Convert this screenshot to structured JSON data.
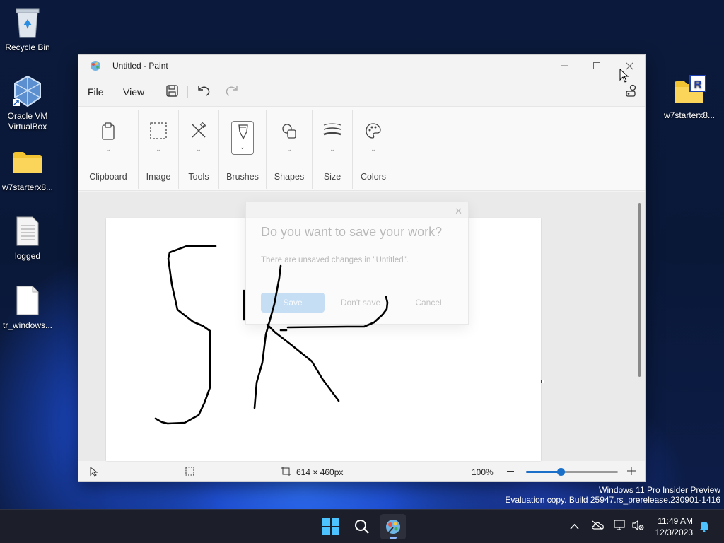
{
  "desktop": {
    "icons": [
      {
        "label": "Recycle Bin",
        "icon": "recycle-bin-icon"
      },
      {
        "label": "Oracle VM VirtualBox",
        "icon": "virtualbox-icon"
      },
      {
        "label": "w7starterx8...",
        "icon": "folder-icon"
      },
      {
        "label": "logged",
        "icon": "text-file-icon"
      },
      {
        "label": "tr_windows...",
        "icon": "file-icon"
      },
      {
        "label": "w7starterx8...",
        "icon": "folder-shortcut-icon"
      }
    ]
  },
  "window": {
    "title": "Untitled - Paint",
    "menu": {
      "file": "File",
      "view": "View"
    },
    "ribbon": {
      "groups": [
        "Clipboard",
        "Image",
        "Tools",
        "Brushes",
        "Shapes",
        "Size",
        "Colors"
      ]
    },
    "dialog": {
      "title": "Do you want to save your work?",
      "message": "There are unsaved changes in \"Untitled\".",
      "save": "Save",
      "dont_save": "Don't save",
      "cancel": "Cancel"
    },
    "status": {
      "canvas_size": "614 × 460px",
      "zoom": "100%",
      "zoom_fraction": 0.38
    }
  },
  "watermark": {
    "line1": "Windows 11 Pro Insider Preview",
    "line2": "Evaluation copy. Build 25947.rs_prerelease.230901-1416"
  },
  "taskbar": {
    "time": "11:49 AM",
    "date": "12/3/2023"
  },
  "colors": {
    "accent": "#1a6fc8",
    "dialog_primary": "#c6def4"
  }
}
